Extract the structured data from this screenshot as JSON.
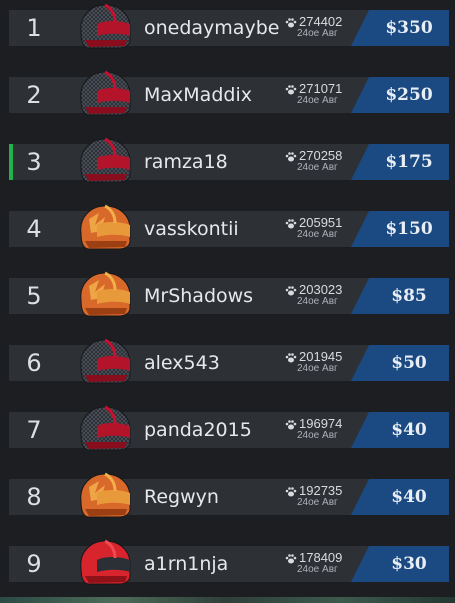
{
  "leaderboard": {
    "entries": [
      {
        "rank": "1",
        "name": "onedaymaybe",
        "score": "274402",
        "ago": "24ое Авг",
        "prize": "$350",
        "helmet": "carbon-red-helmet-icon",
        "highlight": false
      },
      {
        "rank": "2",
        "name": "MaxMaddix",
        "score": "271071",
        "ago": "24ое Авг",
        "prize": "$250",
        "helmet": "carbon-red-helmet-icon",
        "highlight": false
      },
      {
        "rank": "3",
        "name": "ramza18",
        "score": "270258",
        "ago": "24ое Авг",
        "prize": "$175",
        "helmet": "carbon-red-helmet-icon",
        "highlight": true
      },
      {
        "rank": "4",
        "name": "vasskontii",
        "score": "205951",
        "ago": "24ое Авг",
        "prize": "$150",
        "helmet": "orange-flame-helmet-icon",
        "highlight": false
      },
      {
        "rank": "5",
        "name": "MrShadows",
        "score": "203023",
        "ago": "24ое Авг",
        "prize": "$85",
        "helmet": "orange-flame-helmet-icon",
        "highlight": false
      },
      {
        "rank": "6",
        "name": "alex543",
        "score": "201945",
        "ago": "24ое Авг",
        "prize": "$50",
        "helmet": "carbon-red-helmet-icon",
        "highlight": false
      },
      {
        "rank": "7",
        "name": "panda2015",
        "score": "196974",
        "ago": "24ое Авг",
        "prize": "$40",
        "helmet": "carbon-red-helmet-icon",
        "highlight": false
      },
      {
        "rank": "8",
        "name": "Regwyn",
        "score": "192735",
        "ago": "24ое Авг",
        "prize": "$40",
        "helmet": "orange-flame-helmet-icon",
        "highlight": false
      },
      {
        "rank": "9",
        "name": "a1rn1nja",
        "score": "178409",
        "ago": "24ое Авг",
        "prize": "$30",
        "helmet": "red-helmet-icon",
        "highlight": false
      }
    ]
  },
  "colors": {
    "background": "#1c1e22",
    "row": "#2d3035",
    "prize": "#1b4a82",
    "highlight": "#22b14c"
  }
}
